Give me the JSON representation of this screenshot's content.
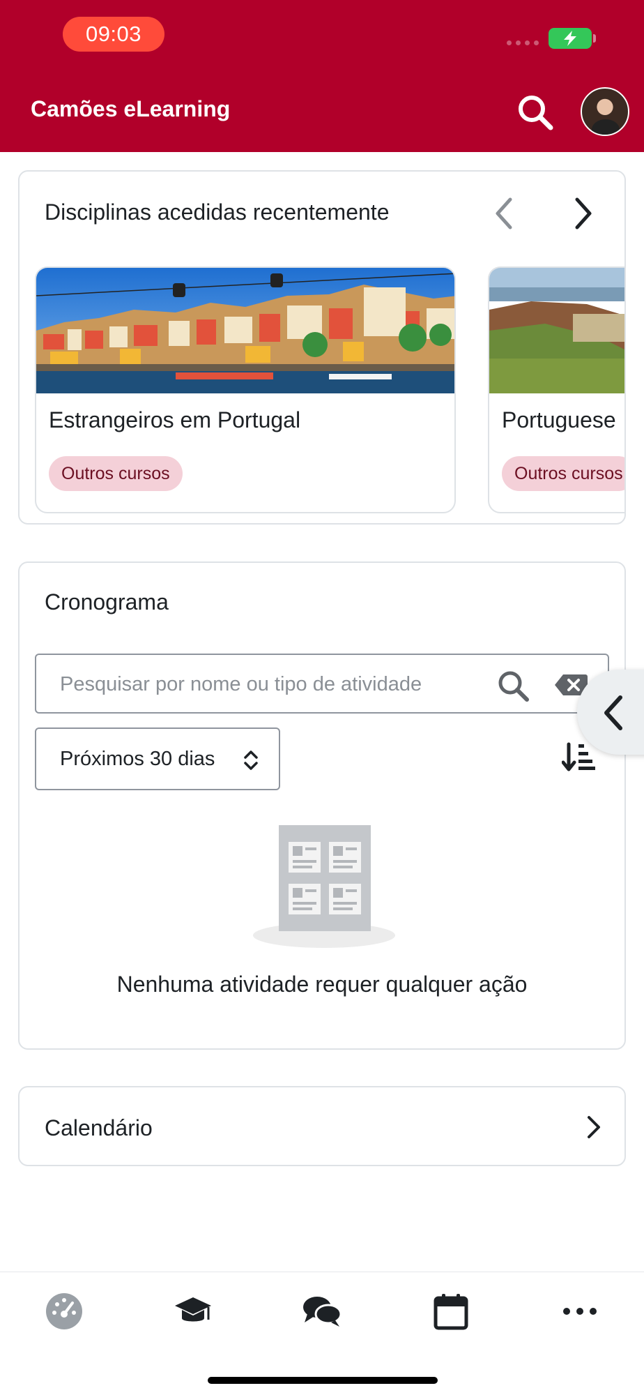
{
  "status_bar": {
    "time": "09:03"
  },
  "header": {
    "title": "Camões eLearning"
  },
  "recent_courses": {
    "title": "Disciplinas acedidas recentemente",
    "courses": [
      {
        "name": "Estrangeiros em Portugal",
        "category": "Outros cursos"
      },
      {
        "name": "Portuguese",
        "category": "Outros cursos"
      }
    ]
  },
  "timeline": {
    "title": "Cronograma",
    "search_placeholder": "Pesquisar por nome ou tipo de atividade",
    "filter_value": "Próximos 30 dias",
    "empty_message": "Nenhuma atividade requer qualquer ação"
  },
  "calendar": {
    "title": "Calendário"
  },
  "tabs": [
    "dashboard-icon",
    "courses-icon",
    "messages-icon",
    "calendar-icon",
    "more-icon"
  ],
  "colors": {
    "brand": "#b1002a",
    "badge_bg": "#f4d0d8",
    "badge_text": "#6b0f22"
  }
}
